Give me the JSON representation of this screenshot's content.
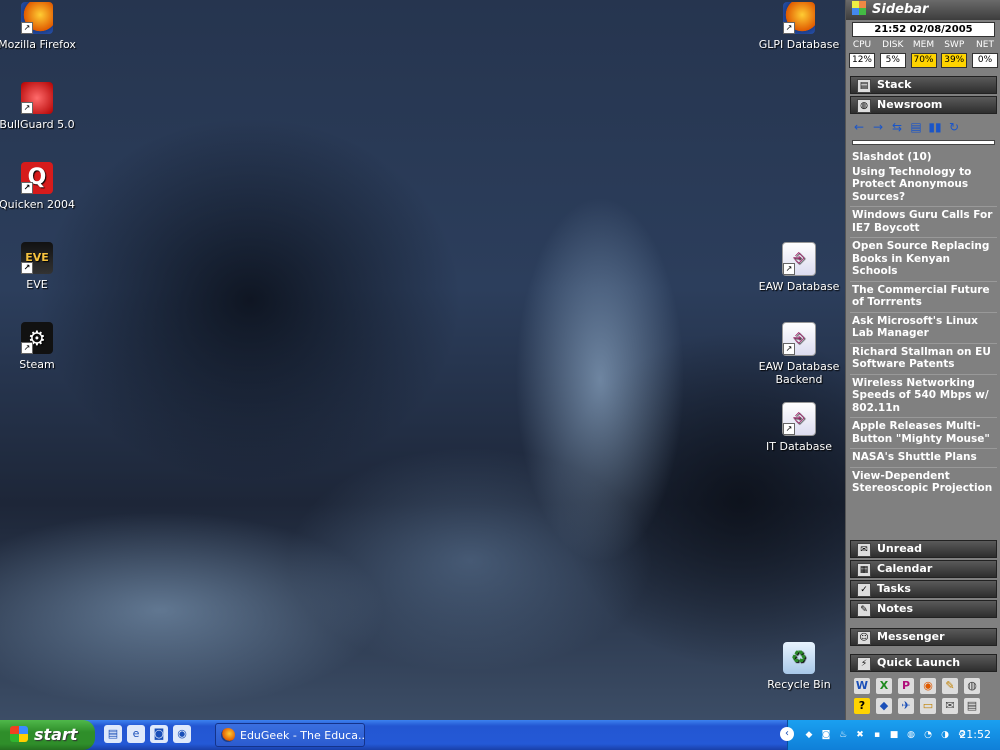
{
  "desktop": {
    "icons_left": [
      {
        "label": "Mozilla Firefox",
        "icon": "firefox-icon"
      },
      {
        "label": "BullGuard 5.0",
        "icon": "bullguard-icon"
      },
      {
        "label": "Quicken 2004",
        "icon": "quicken-icon"
      },
      {
        "label": "EVE",
        "icon": "eve-icon"
      },
      {
        "label": "Steam",
        "icon": "steam-icon"
      }
    ],
    "icons_right": [
      {
        "label": "GLPI Database",
        "icon": "firefox-shortcut-icon"
      },
      {
        "label": "EAW Database",
        "icon": "access-database-icon"
      },
      {
        "label": "EAW Database Backend",
        "icon": "access-database-icon"
      },
      {
        "label": "IT Database",
        "icon": "access-database-icon"
      },
      {
        "label": "Recycle Bin",
        "icon": "recycle-bin-icon"
      }
    ],
    "glyphs": {
      "quicken": "Q",
      "eve": "EVE",
      "steam": "⚙",
      "db": "⎆",
      "bin": "♻",
      "firefox": "",
      "shortcut": "↗"
    }
  },
  "sidebar": {
    "title": "Sidebar",
    "datetime": "21:52 02/08/2005",
    "perf": [
      {
        "label": "CPU",
        "value": "12%"
      },
      {
        "label": "DISK",
        "value": "5%"
      },
      {
        "label": "MEM",
        "value": "70%"
      },
      {
        "label": "SWP",
        "value": "39%"
      },
      {
        "label": "NET",
        "value": "0%"
      }
    ],
    "stack_label": "Stack",
    "newsroom_label": "Newsroom",
    "news_tools": [
      "←",
      "→",
      "⇆",
      "▤",
      "▮▮",
      "↻"
    ],
    "feed_title": "Slashdot (10)",
    "news": [
      "Using Technology to Protect Anonymous Sources?",
      "Windows Guru Calls For IE7 Boycott",
      "Open Source Replacing Books in Kenyan Schools",
      "The Commercial Future of Torrrents",
      "Ask Microsoft's Linux Lab Manager",
      "Richard Stallman on EU Software Patents",
      "Wireless Networking Speeds of 540 Mbps w/ 802.11n",
      "Apple Releases Multi-Button \"Mighty Mouse\"",
      "NASA's Shuttle Plans",
      "View-Dependent Stereoscopic Projection"
    ],
    "sections": [
      "Unread",
      "Calendar",
      "Tasks",
      "Notes",
      "Messenger",
      "Quick Launch"
    ],
    "section_glyphs": [
      "✉",
      "▦",
      "✓",
      "✎",
      "☺",
      "⚡"
    ],
    "quick_launch": [
      "W",
      "X",
      "P",
      "◉",
      "✎",
      "◍",
      "?",
      "◆",
      "✈",
      "▭",
      "✉",
      "▤"
    ]
  },
  "taskbar": {
    "start_label": "start",
    "quick_launch": [
      "▤",
      "e",
      "◙",
      "◉"
    ],
    "active_task": "EduGeek - The Educa...",
    "tray_glyphs": [
      "◆",
      "◙",
      "♨",
      "✖",
      "▪",
      "■",
      "◍",
      "◔",
      "◑",
      "⚙"
    ],
    "collapse_glyph": "‹",
    "clock": "21:52"
  }
}
